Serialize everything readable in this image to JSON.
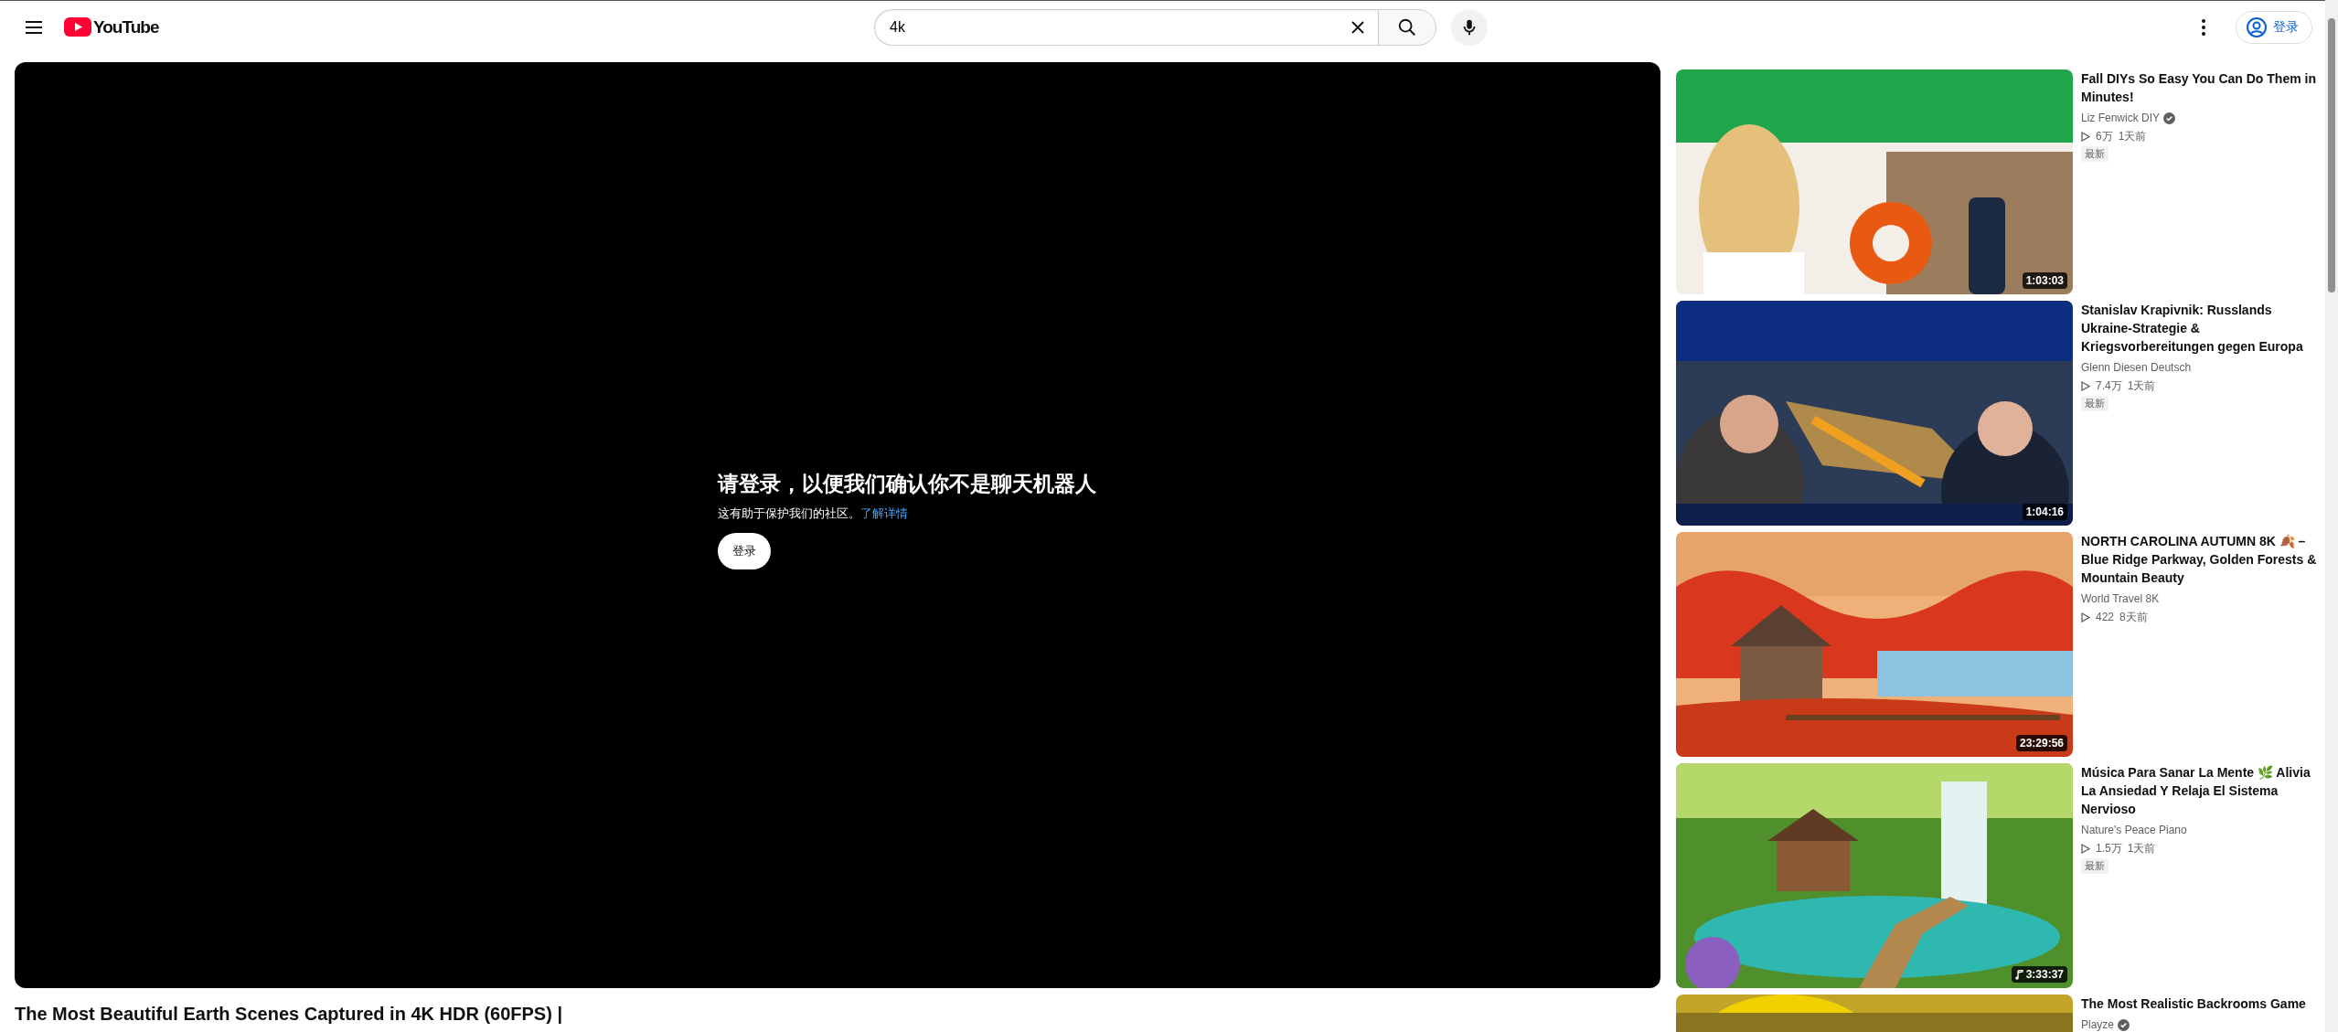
{
  "masthead": {
    "logo": "YouTube",
    "search": {
      "value": "4k"
    },
    "sign_in": "登录"
  },
  "player": {
    "heading": "请登录，以便我们确认你不是聊天机器人",
    "note": "这有助于保护我们的社区。",
    "link": "了解详情",
    "button": "登录"
  },
  "video_title": "The Most Beautiful Earth Scenes Captured in 4K HDR (60FPS) |",
  "recommendations": [
    {
      "duration": "1:03:03",
      "audio": false,
      "title": "Fall DIYs So Easy You Can Do Them in Minutes!",
      "channel": "Liz Fenwick DIY",
      "verified": true,
      "views": "6万",
      "age": "1天前",
      "badge": "最新"
    },
    {
      "duration": "1:04:16",
      "audio": false,
      "title": "Stanislav Krapivnik: Russlands Ukraine-Strategie & Kriegsvorbereitungen gegen Europa",
      "channel": "Glenn Diesen Deutsch",
      "verified": false,
      "views": "7.4万",
      "age": "1天前",
      "badge": "最新"
    },
    {
      "duration": "23:29:56",
      "audio": false,
      "title": "NORTH CAROLINA AUTUMN 8K 🍂 – Blue Ridge Parkway, Golden Forests & Mountain Beauty",
      "channel": "World Travel 8K",
      "verified": false,
      "views": "422",
      "age": "8天前"
    },
    {
      "duration": "3:33:37",
      "audio": true,
      "title": "Música Para Sanar La Mente 🌿 Alivia La Ansiedad Y Relaja El Sistema Nervioso",
      "channel": "Nature's Peace Piano",
      "verified": false,
      "views": "1.5万",
      "age": "1天前",
      "badge": "最新"
    },
    {
      "title": "The Most Realistic Backrooms Game",
      "channel": "Playze",
      "verified": true
    }
  ]
}
